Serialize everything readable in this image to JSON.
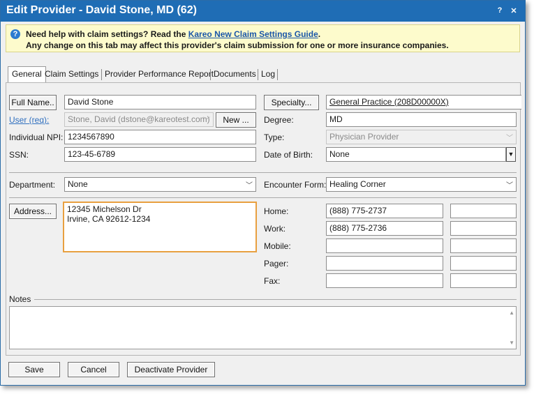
{
  "window": {
    "title": "Edit Provider - David Stone, MD (62)",
    "help_button": "?",
    "close_button": "✕"
  },
  "help_banner": {
    "line1_prefix": "Need help with claim settings? Read the ",
    "link_text": "Kareo New Claim Settings Guide",
    "line1_suffix": ".",
    "line2": "Any change on this tab may affect this provider's claim submission for one or more insurance companies."
  },
  "tabs": [
    "General",
    "Claim Settings",
    "Provider Performance Report",
    "Documents",
    "Log"
  ],
  "form": {
    "full_name_button": "Full Name..",
    "full_name_value": "David Stone",
    "user_label": "User (req):",
    "user_value": "Stone, David (dstone@kareotest.com)",
    "new_button": "New ...",
    "individual_npi_label": "Individual NPI:",
    "individual_npi_value": "1234567890",
    "ssn_label": "SSN:",
    "ssn_value": "123-45-6789",
    "specialty_button": "Specialty...",
    "specialty_value": "General Practice (208D00000X)",
    "degree_label": "Degree:",
    "degree_value": "MD",
    "type_label": "Type:",
    "type_value": "Physician Provider",
    "dob_label": "Date of Birth:",
    "dob_value": "None",
    "department_label": "Department:",
    "department_value": "None",
    "encounter_form_label": "Encounter Form:",
    "encounter_form_value": "Healing Corner",
    "address_button": "Address...",
    "address_line1": "12345 Michelson Dr",
    "address_line2": "Irvine, CA 92612-1234",
    "home_label": "Home:",
    "home_value": "(888) 775-2737",
    "work_label": "Work:",
    "work_value": "(888) 775-2736",
    "mobile_label": "Mobile:",
    "pager_label": "Pager:",
    "fax_label": "Fax:",
    "notes_label": "Notes"
  },
  "footer": {
    "save": "Save",
    "cancel": "Cancel",
    "deactivate": "Deactivate Provider"
  },
  "colors": {
    "titlebar": "#1f6db5",
    "banner": "#fdfbcc",
    "address_focus": "#e8a040"
  }
}
